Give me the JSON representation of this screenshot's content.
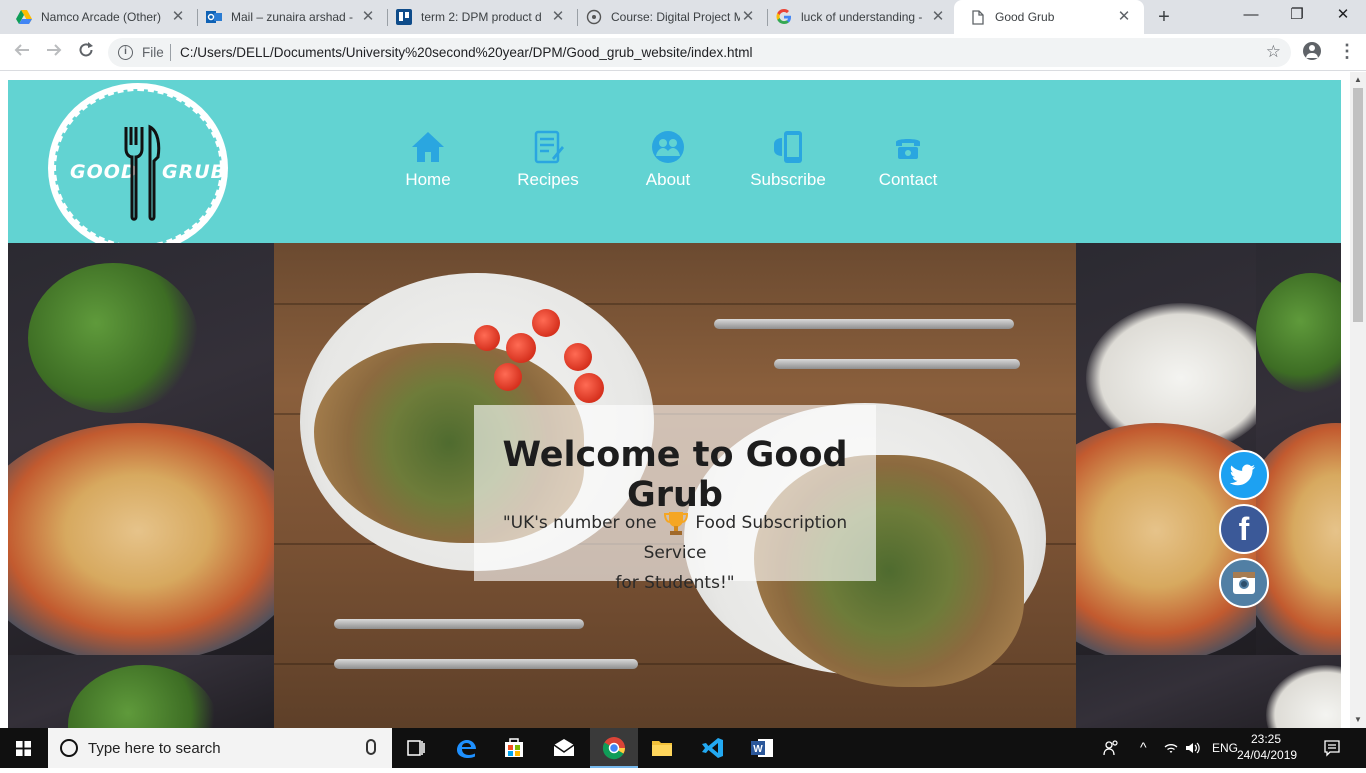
{
  "browser": {
    "tabs": [
      {
        "title": "Namco Arcade (Other)"
      },
      {
        "title": "Mail – zunaira arshad -"
      },
      {
        "title": "term 2: DPM product d"
      },
      {
        "title": "Course: Digital Project M"
      },
      {
        "title": "luck of understanding -"
      },
      {
        "title": "Good Grub"
      }
    ],
    "file_label": "File",
    "url": "C:/Users/DELL/Documents/University%20second%20year/DPM/Good_grub_website/index.html"
  },
  "site": {
    "logo": {
      "left": "GOOD",
      "right": "GRUB"
    },
    "nav": [
      {
        "label": "Home",
        "icon": "home-icon"
      },
      {
        "label": "Recipes",
        "icon": "recipes-icon"
      },
      {
        "label": "About",
        "icon": "about-icon"
      },
      {
        "label": "Subscribe",
        "icon": "subscribe-icon"
      },
      {
        "label": "Contact",
        "icon": "contact-icon"
      }
    ],
    "hero": {
      "title": "Welcome to Good Grub",
      "subtitle_before": "\"UK's number one",
      "subtitle_after": "Food Subscription Service",
      "subtitle_line2": "for Students!\""
    },
    "social": [
      "twitter",
      "facebook",
      "instagram"
    ],
    "facebook_glyph": "f"
  },
  "colors": {
    "header": "#62d3d2",
    "nav_icon": "#2aa6e0"
  },
  "taskbar": {
    "search_placeholder": "Type here to search",
    "language": "ENG",
    "time": "23:25",
    "date": "24/04/2019"
  }
}
